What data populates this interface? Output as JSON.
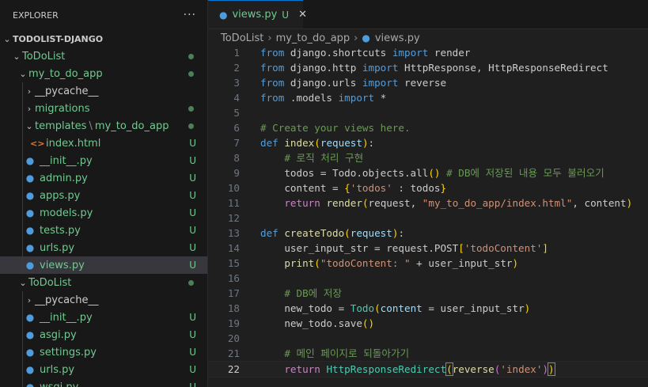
{
  "explorer": {
    "title": "EXPLORER",
    "more": "···",
    "root": "TODOLIST-DJANGO"
  },
  "tree": [
    {
      "label": "ToDoList",
      "indent": 1,
      "chevron": "down",
      "status": "dot",
      "color": "green"
    },
    {
      "label": "my_to_do_app",
      "indent": 2,
      "chevron": "down",
      "status": "dot",
      "color": "green"
    },
    {
      "label": "__pycache__",
      "indent": 3,
      "chevron": "right",
      "status": "",
      "color": "normal"
    },
    {
      "label": "migrations",
      "indent": 3,
      "chevron": "right",
      "status": "dot",
      "color": "green"
    },
    {
      "label": "templates",
      "label2": "my_to_do_app",
      "indent": 3,
      "chevron": "down",
      "status": "dot",
      "color": "green"
    },
    {
      "label": "index.html",
      "indent": 4,
      "icon": "html",
      "status": "U",
      "color": "green"
    },
    {
      "label": "__init__.py",
      "indent": 3,
      "icon": "py",
      "status": "U",
      "color": "green"
    },
    {
      "label": "admin.py",
      "indent": 3,
      "icon": "py",
      "status": "U",
      "color": "green"
    },
    {
      "label": "apps.py",
      "indent": 3,
      "icon": "py",
      "status": "U",
      "color": "green"
    },
    {
      "label": "models.py",
      "indent": 3,
      "icon": "py",
      "status": "U",
      "color": "green"
    },
    {
      "label": "tests.py",
      "indent": 3,
      "icon": "py",
      "status": "U",
      "color": "green"
    },
    {
      "label": "urls.py",
      "indent": 3,
      "icon": "py",
      "status": "U",
      "color": "green"
    },
    {
      "label": "views.py",
      "indent": 3,
      "icon": "py",
      "status": "U",
      "color": "green",
      "selected": true
    },
    {
      "label": "ToDoList",
      "indent": 2,
      "chevron": "down",
      "status": "dot",
      "color": "green"
    },
    {
      "label": "__pycache__",
      "indent": 3,
      "chevron": "right",
      "status": "",
      "color": "normal"
    },
    {
      "label": "__init__.py",
      "indent": 3,
      "icon": "py",
      "status": "U",
      "color": "green"
    },
    {
      "label": "asgi.py",
      "indent": 3,
      "icon": "py",
      "status": "U",
      "color": "green"
    },
    {
      "label": "settings.py",
      "indent": 3,
      "icon": "py",
      "status": "U",
      "color": "green"
    },
    {
      "label": "urls.py",
      "indent": 3,
      "icon": "py",
      "status": "U",
      "color": "green"
    },
    {
      "label": "wsgi.py",
      "indent": 3,
      "icon": "py",
      "status": "U",
      "color": "green"
    }
  ],
  "tab": {
    "name": "views.py",
    "status": "U",
    "close": "✕"
  },
  "breadcrumb": [
    "ToDoList",
    "my_to_do_app",
    "views.py"
  ],
  "active_line": 22,
  "code": [
    [
      [
        "k",
        "from"
      ],
      [
        "t",
        " django.shortcuts "
      ],
      [
        "k",
        "import"
      ],
      [
        "t",
        " render"
      ]
    ],
    [
      [
        "k",
        "from"
      ],
      [
        "t",
        " django.http "
      ],
      [
        "k",
        "import"
      ],
      [
        "t",
        " HttpResponse, HttpResponseRedirect"
      ]
    ],
    [
      [
        "k",
        "from"
      ],
      [
        "t",
        " django.urls "
      ],
      [
        "k",
        "import"
      ],
      [
        "t",
        " reverse"
      ]
    ],
    [
      [
        "k",
        "from"
      ],
      [
        "t",
        " .models "
      ],
      [
        "k",
        "import"
      ],
      [
        "t",
        " *"
      ]
    ],
    [],
    [
      [
        "cm",
        "# Create your views here."
      ]
    ],
    [
      [
        "k",
        "def"
      ],
      [
        "t",
        " "
      ],
      [
        "fn",
        "index"
      ],
      [
        "br1",
        "("
      ],
      [
        "var",
        "request"
      ],
      [
        "br1",
        ")"
      ],
      [
        "t",
        ":"
      ]
    ],
    [
      [
        "t",
        "    "
      ],
      [
        "cm",
        "# 로직 처리 구현"
      ]
    ],
    [
      [
        "t",
        "    todos = Todo.objects.all"
      ],
      [
        "br1",
        "()"
      ],
      [
        "t",
        " "
      ],
      [
        "cm",
        "# DB에 저장된 내용 모두 불러오기"
      ]
    ],
    [
      [
        "t",
        "    content = "
      ],
      [
        "br1",
        "{"
      ],
      [
        "str",
        "'todos'"
      ],
      [
        "t",
        " : todos"
      ],
      [
        "br1",
        "}"
      ]
    ],
    [
      [
        "t",
        "    "
      ],
      [
        "ki",
        "return"
      ],
      [
        "t",
        " "
      ],
      [
        "fn",
        "render"
      ],
      [
        "br1",
        "("
      ],
      [
        "t",
        "request, "
      ],
      [
        "str",
        "\"my_to_do_app/index.html\""
      ],
      [
        "t",
        ", content"
      ],
      [
        "br1",
        ")"
      ]
    ],
    [],
    [
      [
        "k",
        "def"
      ],
      [
        "t",
        " "
      ],
      [
        "fn",
        "createTodo"
      ],
      [
        "br1",
        "("
      ],
      [
        "var",
        "request"
      ],
      [
        "br1",
        ")"
      ],
      [
        "t",
        ":"
      ]
    ],
    [
      [
        "t",
        "    user_input_str = request.POST"
      ],
      [
        "br1",
        "["
      ],
      [
        "str",
        "'todoContent'"
      ],
      [
        "br1",
        "]"
      ]
    ],
    [
      [
        "t",
        "    "
      ],
      [
        "fn",
        "print"
      ],
      [
        "br1",
        "("
      ],
      [
        "str",
        "\"todoContent: \""
      ],
      [
        "t",
        " + user_input_str"
      ],
      [
        "br1",
        ")"
      ]
    ],
    [],
    [
      [
        "t",
        "    "
      ],
      [
        "cm",
        "# DB에 저장"
      ]
    ],
    [
      [
        "t",
        "    new_todo = "
      ],
      [
        "cls",
        "Todo"
      ],
      [
        "br1",
        "("
      ],
      [
        "var",
        "content"
      ],
      [
        "t",
        " = user_input_str"
      ],
      [
        "br1",
        ")"
      ]
    ],
    [
      [
        "t",
        "    new_todo.save"
      ],
      [
        "br1",
        "()"
      ]
    ],
    [],
    [
      [
        "t",
        "    "
      ],
      [
        "cm",
        "# 메인 페이지로 되돌아가기"
      ]
    ],
    [
      [
        "t",
        "    "
      ],
      [
        "ki",
        "return"
      ],
      [
        "t",
        " "
      ],
      [
        "cls",
        "HttpResponseRedirect"
      ],
      [
        "br1box",
        "("
      ],
      [
        "fn",
        "reverse"
      ],
      [
        "br2",
        "("
      ],
      [
        "str",
        "'index'"
      ],
      [
        "br2",
        ")"
      ],
      [
        "br1box",
        ")"
      ]
    ]
  ]
}
